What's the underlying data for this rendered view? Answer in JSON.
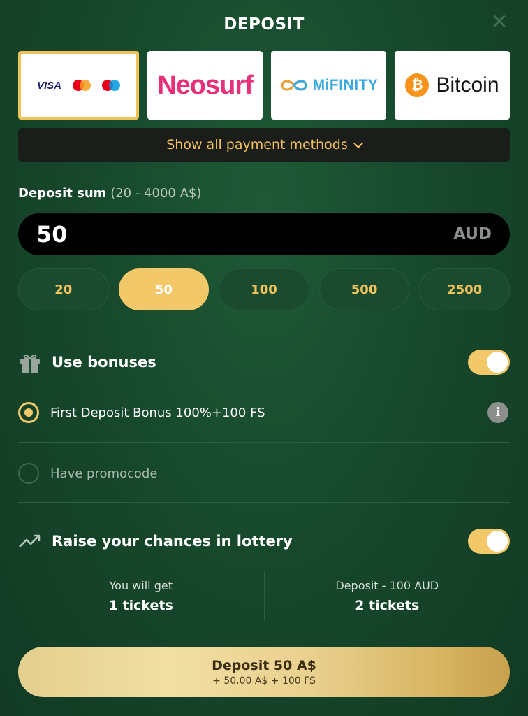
{
  "header": {
    "title": "DEPOSIT",
    "close_icon": "close-icon"
  },
  "payment_methods": [
    {
      "name": "Visa / Mastercard / Maestro",
      "visa_label": "VISA",
      "selected": true
    },
    {
      "name": "Neosurf",
      "label": "Neosurf",
      "selected": false
    },
    {
      "name": "MiFinity",
      "label": "MiFINITY",
      "selected": false
    },
    {
      "name": "Bitcoin",
      "label": "Bitcoin",
      "coin_symbol": "₿",
      "selected": false
    }
  ],
  "show_all": {
    "label": "Show all payment methods",
    "icon": "chevron-down-icon"
  },
  "deposit_sum": {
    "label": "Deposit sum",
    "range": "(20 - 4000 A$)",
    "value": "50",
    "currency": "AUD"
  },
  "presets": [
    {
      "label": "20",
      "active": false
    },
    {
      "label": "50",
      "active": true
    },
    {
      "label": "100",
      "active": false
    },
    {
      "label": "500",
      "active": false
    },
    {
      "label": "2500",
      "active": false
    }
  ],
  "bonuses": {
    "title": "Use bonuses",
    "icon": "gift-icon",
    "enabled": true,
    "options": [
      {
        "label": "First Deposit Bonus 100%+100 FS",
        "selected": true,
        "info_icon": "info-icon",
        "info_glyph": "i"
      },
      {
        "label": "Have promocode",
        "selected": false
      }
    ]
  },
  "lottery": {
    "title": "Raise your chances in lottery",
    "icon": "trending-up-icon",
    "enabled": true,
    "current": {
      "label": "You will get",
      "value": "1 tickets"
    },
    "upgrade": {
      "label": "Deposit - 100 AUD",
      "value": "2 tickets"
    }
  },
  "deposit_button": {
    "label": "Deposit 50 A$",
    "sublabel": "+ 50.00 A$ + 100 FS"
  },
  "colors": {
    "background": "#17492c",
    "accent": "#f3c868",
    "link_gold": "#f0c15c",
    "input_bg": "#000000"
  }
}
